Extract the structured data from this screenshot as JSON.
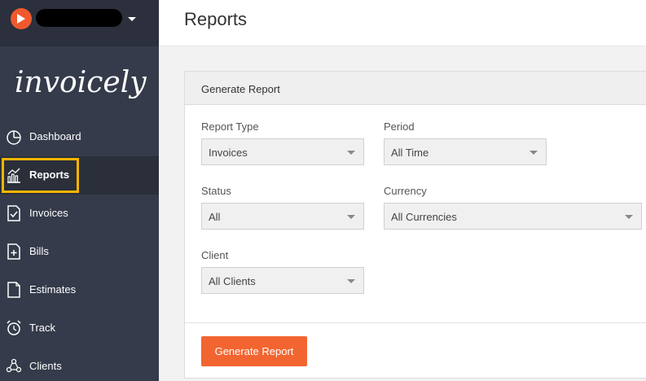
{
  "app": {
    "logo_text": "invoicely",
    "colors": {
      "accent": "#f26531",
      "sidebar": "#353b4a",
      "highlight": "#f7b500"
    }
  },
  "sidebar": {
    "items": [
      {
        "label": "Dashboard",
        "icon": "dashboard-icon"
      },
      {
        "label": "Reports",
        "icon": "reports-icon",
        "active": true
      },
      {
        "label": "Invoices",
        "icon": "invoice-icon"
      },
      {
        "label": "Bills",
        "icon": "bill-icon"
      },
      {
        "label": "Estimates",
        "icon": "estimate-icon"
      },
      {
        "label": "Track",
        "icon": "alarm-clock-icon"
      },
      {
        "label": "Clients",
        "icon": "clients-icon"
      }
    ]
  },
  "header": {
    "title": "Reports"
  },
  "form": {
    "title": "Generate Report",
    "report_type": {
      "label": "Report Type",
      "value": "Invoices"
    },
    "period": {
      "label": "Period",
      "value": "All Time"
    },
    "status": {
      "label": "Status",
      "value": "All"
    },
    "currency": {
      "label": "Currency",
      "value": "All Currencies"
    },
    "client": {
      "label": "Client",
      "value": "All Clients"
    },
    "submit_label": "Generate Report"
  }
}
